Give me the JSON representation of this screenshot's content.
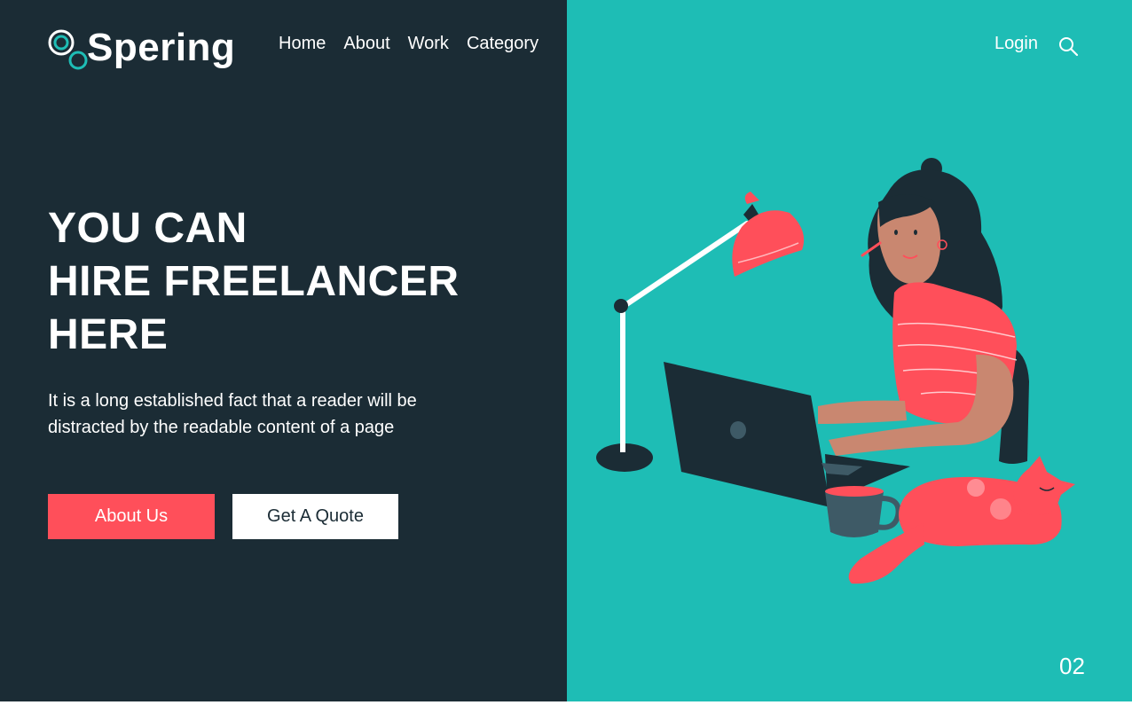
{
  "brand": {
    "name": "Spering"
  },
  "nav": {
    "items": [
      {
        "label": "Home"
      },
      {
        "label": "About"
      },
      {
        "label": "Work"
      },
      {
        "label": "Category"
      }
    ]
  },
  "header": {
    "login_label": "Login",
    "search_icon": "search-icon"
  },
  "hero": {
    "title_lines": [
      "YOU CAN",
      "HIRE FREELANCER",
      "HERE"
    ],
    "description_lines": [
      "It is a long established fact that a reader will be",
      "distracted by the readable content of a page"
    ],
    "primary_button": "About Us",
    "secondary_button": "Get A Quote"
  },
  "slide": {
    "number": "02"
  },
  "colors": {
    "dark_bg": "#1b2c35",
    "teal_bg": "#1ebdb5",
    "accent_red": "#ff4f5a",
    "white": "#ffffff"
  }
}
